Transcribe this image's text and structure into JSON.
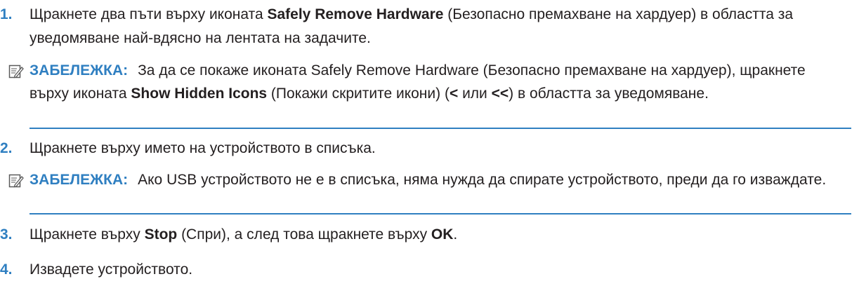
{
  "steps": [
    {
      "number": "1.",
      "text_a": "Щракнете два пъти върху иконата ",
      "bold_a": "Safely Remove Hardware",
      "text_b": " (Безопасно премахване на хардуер) в областта за уведомяване най-вдясно на лентата на задачите."
    },
    {
      "number": "2.",
      "text_a": "Щракнете върху името на устройството в списъка."
    },
    {
      "number": "3.",
      "text_a": "Щракнете върху ",
      "bold_a": "Stop",
      "text_b": " (Спри), а след това щракнете върху ",
      "bold_b": "OK",
      "text_c": "."
    },
    {
      "number": "4.",
      "text_a": "Извадете устройството."
    }
  ],
  "notes": [
    {
      "label": "ЗАБЕЛЕЖКА:",
      "text_a": "За да се покаже иконата Safely Remove Hardware (Безопасно премахване на хардуер), щракнете върху иконата ",
      "bold_a": "Show Hidden Icons",
      "text_b": " (Покажи скритите икони) (",
      "bold_b": "<",
      "text_c": " или ",
      "bold_c": "<<",
      "text_d": ") в областта за уведомяване."
    },
    {
      "label": "ЗАБЕЛЕЖКА:",
      "text_a": "Ако USB устройството не е в списъка, няма нужда да спирате устройството, преди да го изваждате."
    }
  ],
  "icons": {
    "note": "note-pencil-icon"
  },
  "colors": {
    "accent": "#2f7fc1",
    "text": "#231f20"
  }
}
